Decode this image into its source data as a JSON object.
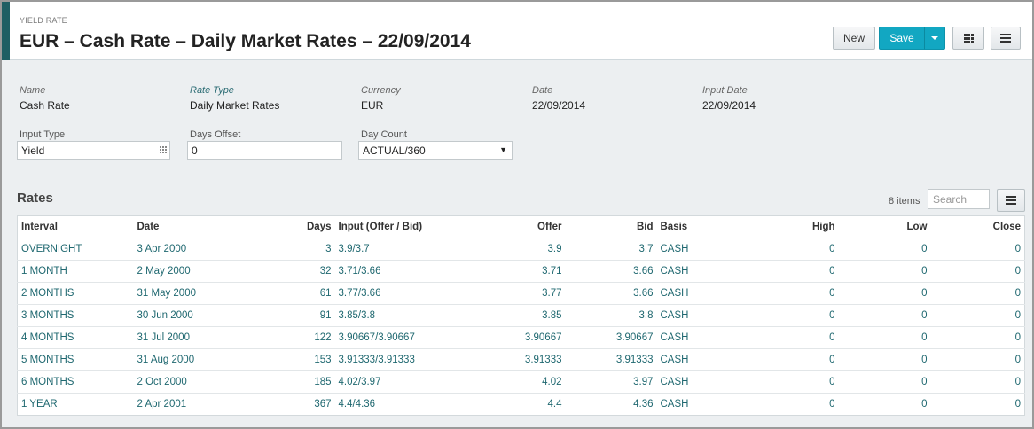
{
  "header": {
    "kicker": "YIELD RATE",
    "title": "EUR – Cash Rate – Daily Market Rates – 22/09/2014",
    "new_label": "New",
    "save_label": "Save"
  },
  "fields": {
    "name": {
      "label": "Name",
      "value": "Cash Rate"
    },
    "rate_type": {
      "label": "Rate Type",
      "value": "Daily Market Rates"
    },
    "currency": {
      "label": "Currency",
      "value": "EUR"
    },
    "date": {
      "label": "Date",
      "value": "22/09/2014"
    },
    "input_date": {
      "label": "Input Date",
      "value": "22/09/2014"
    },
    "input_type": {
      "label": "Input Type",
      "value": "Yield"
    },
    "days_offset": {
      "label": "Days Offset",
      "value": "0"
    },
    "day_count": {
      "label": "Day Count",
      "value": "ACTUAL/360"
    }
  },
  "rates": {
    "title": "Rates",
    "count": "8 items",
    "search_placeholder": "Search",
    "columns": {
      "interval": "Interval",
      "date": "Date",
      "days": "Days",
      "input": "Input (Offer / Bid)",
      "offer": "Offer",
      "bid": "Bid",
      "basis": "Basis",
      "high": "High",
      "low": "Low",
      "close": "Close"
    },
    "rows": [
      {
        "interval": "OVERNIGHT",
        "date": "3 Apr 2000",
        "days": "3",
        "input": "3.9/3.7",
        "offer": "3.9",
        "bid": "3.7",
        "basis": "CASH",
        "high": "0",
        "low": "0",
        "close": "0"
      },
      {
        "interval": "1 MONTH",
        "date": "2 May 2000",
        "days": "32",
        "input": "3.71/3.66",
        "offer": "3.71",
        "bid": "3.66",
        "basis": "CASH",
        "high": "0",
        "low": "0",
        "close": "0"
      },
      {
        "interval": "2 MONTHS",
        "date": "31 May 2000",
        "days": "61",
        "input": "3.77/3.66",
        "offer": "3.77",
        "bid": "3.66",
        "basis": "CASH",
        "high": "0",
        "low": "0",
        "close": "0"
      },
      {
        "interval": "3 MONTHS",
        "date": "30 Jun 2000",
        "days": "91",
        "input": "3.85/3.8",
        "offer": "3.85",
        "bid": "3.8",
        "basis": "CASH",
        "high": "0",
        "low": "0",
        "close": "0"
      },
      {
        "interval": "4 MONTHS",
        "date": "31 Jul 2000",
        "days": "122",
        "input": "3.90667/3.90667",
        "offer": "3.90667",
        "bid": "3.90667",
        "basis": "CASH",
        "high": "0",
        "low": "0",
        "close": "0"
      },
      {
        "interval": "5 MONTHS",
        "date": "31 Aug 2000",
        "days": "153",
        "input": "3.91333/3.91333",
        "offer": "3.91333",
        "bid": "3.91333",
        "basis": "CASH",
        "high": "0",
        "low": "0",
        "close": "0"
      },
      {
        "interval": "6 MONTHS",
        "date": "2 Oct 2000",
        "days": "185",
        "input": "4.02/3.97",
        "offer": "4.02",
        "bid": "3.97",
        "basis": "CASH",
        "high": "0",
        "low": "0",
        "close": "0"
      },
      {
        "interval": "1 YEAR",
        "date": "2 Apr 2001",
        "days": "367",
        "input": "4.4/4.36",
        "offer": "4.4",
        "bid": "4.36",
        "basis": "CASH",
        "high": "0",
        "low": "0",
        "close": "0"
      }
    ]
  },
  "icons": {
    "save_menu": "caret-down-icon",
    "grid_view": "grid-icon",
    "menu": "hamburger-icon",
    "input_type_picker": "dots-grid-icon",
    "day_count_dropdown": "caret-down-icon"
  },
  "colors": {
    "accent": "#1e5e63",
    "save_button": "#12a7c2",
    "link_text": "#1f6870"
  }
}
